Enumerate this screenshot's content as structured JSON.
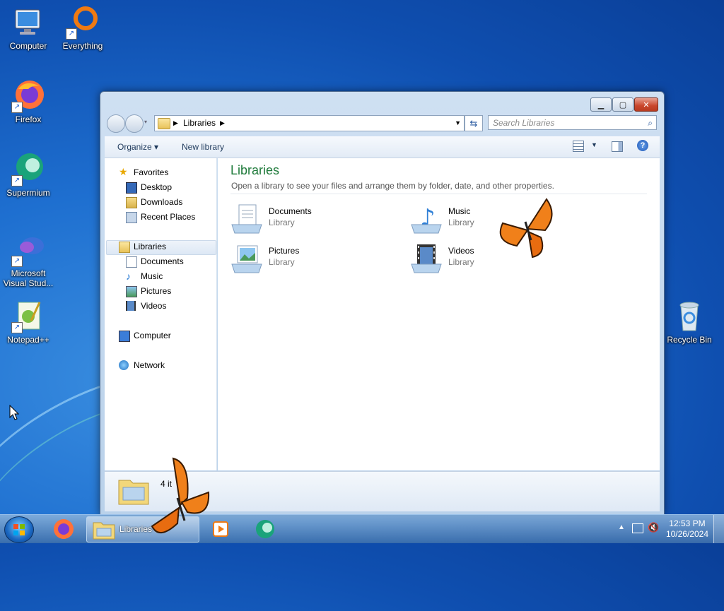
{
  "desktop": {
    "icons": [
      {
        "label": "Computer"
      },
      {
        "label": "Everything"
      },
      {
        "label": "Firefox"
      },
      {
        "label": "Supermium"
      },
      {
        "label": "Microsoft Visual Stud..."
      },
      {
        "label": "Notepad++"
      },
      {
        "label": "Recycle Bin"
      }
    ]
  },
  "window": {
    "address": {
      "crumb": "Libraries"
    },
    "search": {
      "placeholder": "Search Libraries"
    },
    "toolbar": {
      "organize": "Organize ▾",
      "new_library": "New library"
    },
    "nav": {
      "favorites": "Favorites",
      "desktop": "Desktop",
      "downloads": "Downloads",
      "recent_places": "Recent Places",
      "libraries": "Libraries",
      "documents": "Documents",
      "music": "Music",
      "pictures": "Pictures",
      "videos": "Videos",
      "computer": "Computer",
      "network": "Network"
    },
    "content": {
      "title": "Libraries",
      "subtitle": "Open a library to see your files and arrange them by folder, date, and other properties.",
      "libraries": [
        {
          "name": "Documents",
          "type": "Library"
        },
        {
          "name": "Music",
          "type": "Library"
        },
        {
          "name": "Pictures",
          "type": "Library"
        },
        {
          "name": "Videos",
          "type": "Library"
        }
      ]
    },
    "details": {
      "count": "4 it"
    }
  },
  "taskbar": {
    "active_label": "Libraries",
    "clock": {
      "time": "12:53 PM",
      "date": "10/26/2024"
    }
  },
  "colors": {
    "title_green": "#1e7a3a",
    "desktop_blue": "#1e6fd0"
  }
}
